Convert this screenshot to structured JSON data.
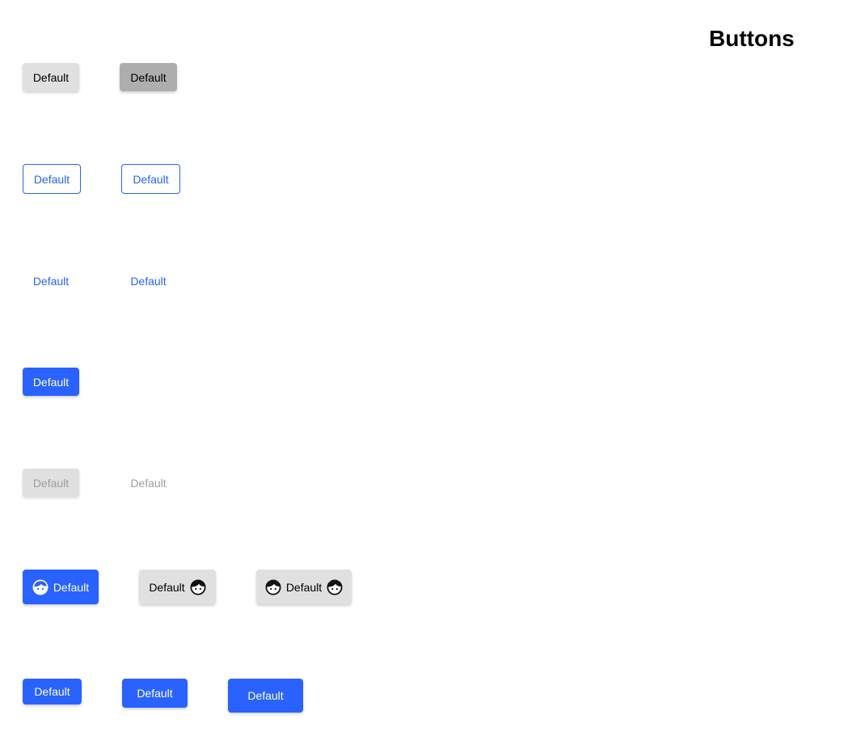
{
  "page": {
    "title": "Buttons"
  },
  "colors": {
    "primary": "#2962ff",
    "default_bg": "#e0e0e0",
    "default_hover_bg": "#aeaeae",
    "disabled_text": "#9e9e9e"
  },
  "rows": {
    "contained": {
      "default_label": "Default",
      "hover_label": "Default"
    },
    "outlined": {
      "default_label": "Default",
      "hover_label": "Default"
    },
    "text": {
      "default_label": "Default",
      "hover_label": "Default"
    },
    "primary": {
      "label": "Default"
    },
    "disabled": {
      "contained_label": "Default",
      "text_label": "Default"
    },
    "icons": {
      "start_icon_label": "Default",
      "end_icon_label": "Default",
      "both_icons_label": "Default",
      "icon_name": "face-icon"
    },
    "sizes": {
      "small_label": "Default",
      "medium_label": "Default",
      "large_label": "Default"
    }
  }
}
